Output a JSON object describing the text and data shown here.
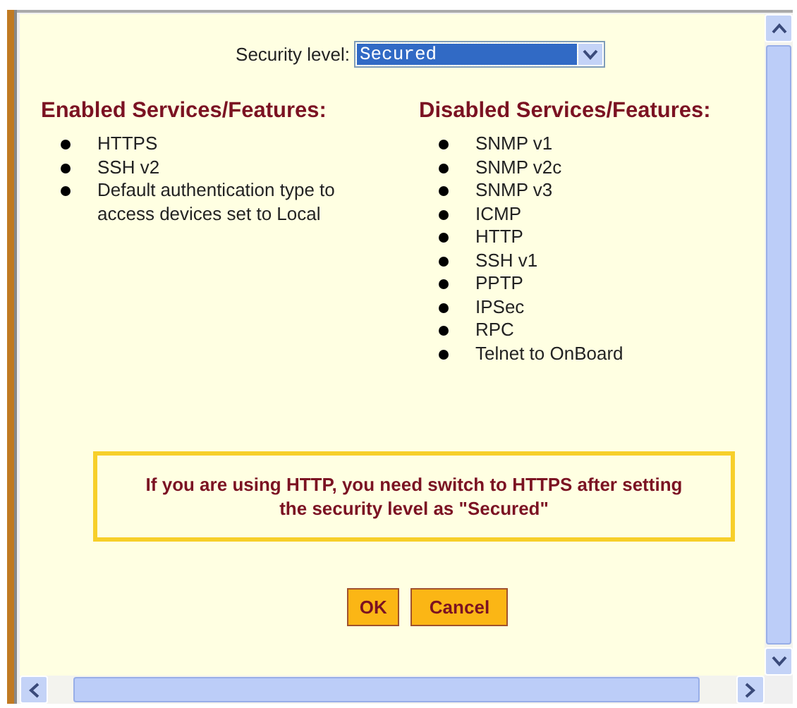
{
  "security_level": {
    "label": "Security level:",
    "value": "Secured"
  },
  "enabled": {
    "heading": "Enabled Services/Features:",
    "items": [
      "HTTPS",
      "SSH v2",
      "Default authentication type to access devices set to Local"
    ]
  },
  "disabled": {
    "heading": "Disabled Services/Features:",
    "items": [
      "SNMP v1",
      "SNMP v2c",
      "SNMP v3",
      "ICMP",
      "HTTP",
      "SSH v1",
      "PPTP",
      "IPSec",
      "RPC",
      "Telnet to OnBoard"
    ]
  },
  "notice": "If you are using HTTP, you need switch to HTTPS after setting the security level as \"Secured\"",
  "buttons": [
    "OK",
    "Cancel"
  ]
}
